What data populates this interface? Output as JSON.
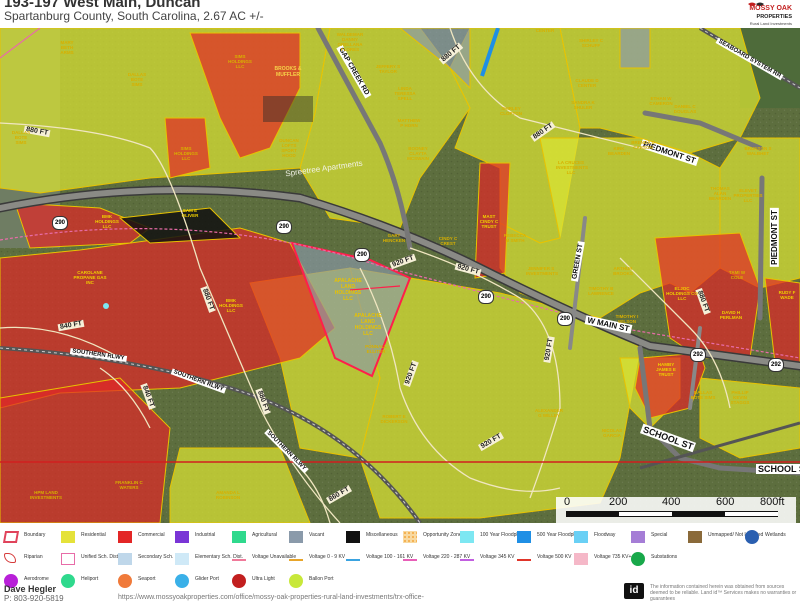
{
  "header": {
    "title": "193-197 West Main, Duncan",
    "subtitle": "Spartanburg County, South Carolina, 2.67 AC +/-",
    "logo_line1": "MOSSY OAK",
    "logo_line2": "PROPERTIES",
    "logo_line3": "Rural Land Investments"
  },
  "map": {
    "roads": [
      "GAP CREEK RD",
      "PIEDMONT ST",
      "PIEDMONT ST",
      "GREEN ST",
      "W MAIN ST",
      "SCHOOL ST",
      "SCHOOL ST",
      "SOUTHERN RLWY",
      "SOUTHERN RLWY",
      "SOUTHERN RLWY",
      "SEABOARD SYSTEM RR"
    ],
    "shields": [
      "290",
      "290",
      "290",
      "290",
      "290",
      "292"
    ],
    "contours": [
      "880 FT",
      "880 FT",
      "880 FT",
      "880 FT",
      "880 FT",
      "880 FT",
      "920 FT",
      "920 FT",
      "920 FT",
      "920 FT",
      "840 FT",
      "840 FT",
      "860 FT"
    ],
    "subject_labels": [
      "APALACHE LAND HOLDINGS LLC",
      "APALACHE LAND HOLDINGS LLC"
    ],
    "owners": [
      "MARY BETH ARMS",
      "DALLAS BOTE SIMS",
      "DALLAS BOTE SIMS",
      "SIMS HOLDINGS LLC",
      "SIMS HOLDINGS LLC",
      "WALDEMAR DANNY ORELLANA FLORES",
      "JEFFERY S TAYLOR",
      "LINDA TERESSA SPELL",
      "MATTHEW P HORN",
      "BOONEY CLAYTA MCSWAIN",
      "DUNCAN LOFTS SPORT HOOD",
      "BMK HOLDINGS LLC",
      "SAM E OLIVER",
      "CAROLANE PROPANE GAS INC",
      "BMK HOLDINGS LLC",
      "GARY HENCKEN",
      "CINDY C CREST",
      "MAST CINDY C TRUST",
      "REBECCA M SMITH",
      "PONNALL ELLITER",
      "ROBERT E DICKERSON",
      "ALEXANDER G WILLEY",
      "NICOLAS GARCIA",
      "HPM LAND INVESTMENTS",
      "FRANKLIN C WATERS",
      "AMANDA L ROBINSON",
      "SHIRLEY CLOPTON",
      "CLAUDE D CENTER",
      "SANDRA K SHULER",
      "LA CRUCES INVESTMENTS LLC",
      "KIRK BEARDEN",
      "BRENDA D CARSON",
      "JENNIFER S INVESTMENTS",
      "TIMOTHY B LAWRENCE",
      "ARTHUR BROOKS",
      "TIMOTHY I WILSON",
      "ELJOC HOLDINGS CO LLC",
      "DAVID H PERLMAN",
      "TAMI W COLE",
      "HAMBY JAMES E TRUST",
      "DALLAS BOTE SIMS",
      "PHILLIP KEVIN STAGGS",
      "RUDY F WADE",
      "ELEVET PROPERTIES LLC",
      "THOMAS ALAN BEARDEN",
      "BRUNSON S WALBHET",
      "DANIEL C DOUGLAS",
      "ETHAN W CAMERON",
      "SHIRLEY C SCHUFF",
      "CENTER"
    ],
    "building_label": "BROOKS & MUFFLER",
    "apartments_label": "Spreetree Apartments"
  },
  "scale": {
    "ticks": [
      "0",
      "200",
      "400",
      "600",
      "800ft"
    ]
  },
  "legend": {
    "items": [
      {
        "label": "Boundary",
        "color": "#e0435b",
        "kind": "boundary"
      },
      {
        "label": "Residential",
        "color": "#e5e23a",
        "kind": "fill"
      },
      {
        "label": "Commercial",
        "color": "#e32626",
        "kind": "fill"
      },
      {
        "label": "Industrial",
        "color": "#7a35d6",
        "kind": "fill"
      },
      {
        "label": "Agricultural",
        "color": "#2fd98d",
        "kind": "fill"
      },
      {
        "label": "Vacant",
        "color": "#8a9aaa",
        "kind": "fill"
      },
      {
        "label": "Miscellaneous",
        "color": "#111111",
        "kind": "fill"
      },
      {
        "label": "Opportunity Zones",
        "color": "#f3a53a",
        "kind": "dots"
      },
      {
        "label": "100 Year Floodplain",
        "color": "#7de7f2",
        "kind": "fill"
      },
      {
        "label": "500 Year Floodplain",
        "color": "#1f8fe5",
        "kind": "fill"
      },
      {
        "label": "Floodway",
        "color": "#6ad0f5",
        "kind": "fill"
      },
      {
        "label": "Special",
        "color": "#a57dd6",
        "kind": "fill"
      },
      {
        "label": "Unmapped/ Not Included",
        "color": "#8a6a3a",
        "kind": "fill"
      },
      {
        "label": "Wetlands",
        "color": "#2a5fb0",
        "kind": "circle"
      },
      {
        "label": "Riparian",
        "color": "#d63b3b",
        "kind": "riparian"
      },
      {
        "label": "Unified Sch. Dist.",
        "color": "#e86ca8",
        "kind": "outline"
      },
      {
        "label": "Secondary Sch. Dist.",
        "color": "#bfd7ea",
        "kind": "fill"
      },
      {
        "label": "Elementary Sch. Dist.",
        "color": "#cfe9f7",
        "kind": "fill"
      },
      {
        "label": "Voltage Unavailable",
        "color": "#f07a9a",
        "kind": "line"
      },
      {
        "label": "Voltage 0 - 9 KV",
        "color": "#e8a52a",
        "kind": "line"
      },
      {
        "label": "Voltage 100 - 161 KV",
        "color": "#3aa3e0",
        "kind": "line"
      },
      {
        "label": "Voltage 220 - 287 KV",
        "color": "#e85fb8",
        "kind": "line"
      },
      {
        "label": "Voltage 345 KV",
        "color": "#c25fe0",
        "kind": "line"
      },
      {
        "label": "Voltage 500 KV",
        "color": "#e0352a",
        "kind": "line"
      },
      {
        "label": "Voltage 735 KV+",
        "color": "#f5b8c8",
        "kind": "fill"
      },
      {
        "label": "Substations",
        "color": "#18a84a",
        "kind": "circle"
      },
      {
        "label": "Aerodrome",
        "color": "#b820d8",
        "kind": "circle"
      },
      {
        "label": "Heliport",
        "color": "#2fd98d",
        "kind": "circle"
      },
      {
        "label": "Seaport",
        "color": "#f07a3a",
        "kind": "circle"
      },
      {
        "label": "Glider Port",
        "color": "#3ab0e8",
        "kind": "circle"
      },
      {
        "label": "Ultra Light",
        "color": "#c21f1f",
        "kind": "circle"
      },
      {
        "label": "Ballon Port",
        "color": "#c8e83a",
        "kind": "circle"
      }
    ]
  },
  "footer": {
    "agent": "Dave Hegler",
    "phone": "P: 803-920-5819",
    "url": "https://www.mossyoakproperties.com/office/mossy-oak-properties-rural-land-investments/trx-office-",
    "id_logo": "id",
    "disclaimer": "The information contained herein was obtained from sources deemed to be reliable. Land id™ Services makes no warranties or guarantees"
  },
  "colors": {
    "residential": "#dbe433",
    "commercial": "#e32626",
    "vacant": "#8a9aaa",
    "boundary": "#ff1f4a",
    "parcel_line": "#e8c200"
  }
}
